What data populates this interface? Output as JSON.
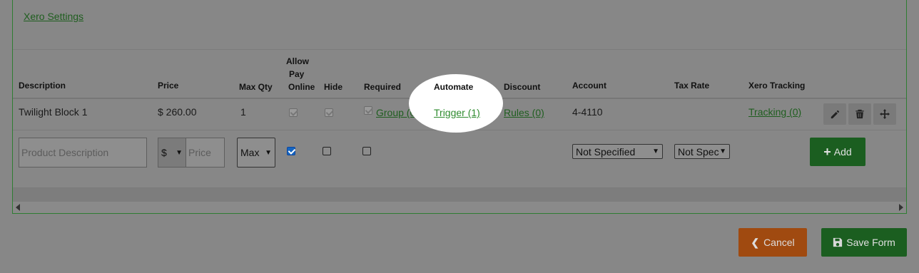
{
  "header": {
    "xero_settings_link": "Xero Settings"
  },
  "table": {
    "columns": {
      "description": "Description",
      "price": "Price",
      "max_qty": "Max Qty",
      "allow_pay_online_l1": "Allow",
      "allow_pay_online_l2": "Pay",
      "allow_pay_online_l3": "Online",
      "hide": "Hide",
      "required": "Required",
      "automate": "Automate",
      "discount": "Discount",
      "account": "Account",
      "tax_rate": "Tax Rate",
      "xero_tracking": "Xero Tracking"
    },
    "row": {
      "description": "Twilight Block 1",
      "price": "$ 260.00",
      "max_qty": "1",
      "group": "Group (0)",
      "trigger": "Trigger (1)",
      "rules": "Rules (0)",
      "account": "4-4110",
      "tracking": "Tracking (0)"
    },
    "new_row": {
      "description_placeholder": "Product Description",
      "currency": "$",
      "price_placeholder": "Price",
      "max_select": "Max",
      "account_select": "Not Specified",
      "tax_select": "Not Spec",
      "add_label": "Add"
    }
  },
  "footer": {
    "cancel_label": "Cancel",
    "save_label": "Save Form"
  },
  "colors": {
    "accent_green": "#1b5e20",
    "cancel_orange": "#a04a10",
    "link_green": "#1f5e1f"
  }
}
